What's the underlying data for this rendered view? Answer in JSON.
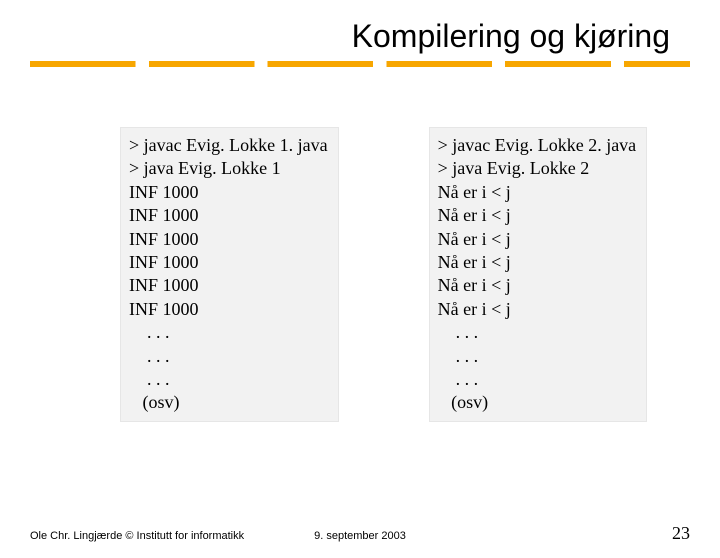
{
  "title": "Kompilering og kjøring",
  "left_box": {
    "lines": [
      "> javac Evig. Lokke 1. java",
      "> java Evig. Lokke 1",
      "INF 1000",
      "INF 1000",
      "INF 1000",
      "INF 1000",
      "INF 1000",
      "INF 1000",
      "    . . .",
      "    . . .",
      "    . . .",
      "   (osv)"
    ]
  },
  "right_box": {
    "lines": [
      "> javac Evig. Lokke 2. java",
      "> java Evig. Lokke 2",
      "Nå er i < j",
      "Nå er i < j",
      "Nå er i < j",
      "Nå er i < j",
      "Nå er i < j",
      "Nå er i < j",
      "    . . .",
      "    . . .",
      "    . . .",
      "   (osv)"
    ]
  },
  "footer": {
    "left": "Ole Chr. Lingjærde © Institutt for informatikk",
    "center": "9. september 2003",
    "right": "23"
  }
}
